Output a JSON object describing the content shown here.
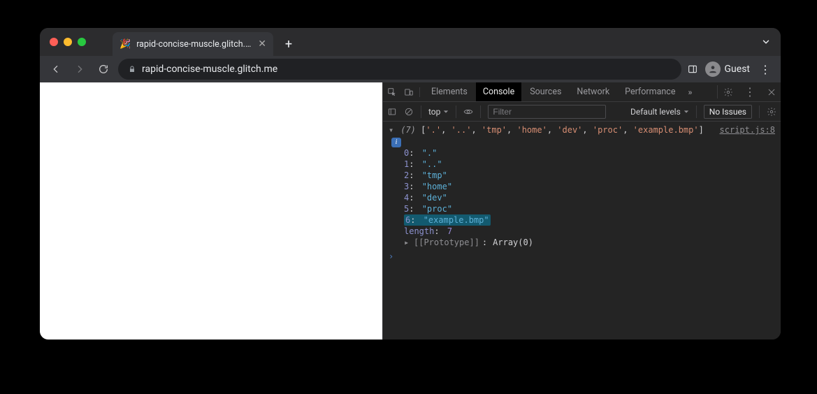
{
  "tab": {
    "title": "rapid-concise-muscle.glitch.me",
    "favicon": "🎉"
  },
  "url": "rapid-concise-muscle.glitch.me",
  "guest_label": "Guest",
  "devtools": {
    "tabs": [
      "Elements",
      "Console",
      "Sources",
      "Network",
      "Performance"
    ],
    "active_tab": "Console",
    "context_label": "top",
    "filter_placeholder": "Filter",
    "levels_label": "Default levels",
    "issues_label": "No Issues"
  },
  "console": {
    "source_link": "script.js:8",
    "array_count": "(7)",
    "summary_items": [
      ".",
      "..",
      "tmp",
      "home",
      "dev",
      "proc",
      "example.bmp"
    ],
    "entries": [
      {
        "k": "0",
        "v": "\".\""
      },
      {
        "k": "1",
        "v": "\"..\""
      },
      {
        "k": "2",
        "v": "\"tmp\""
      },
      {
        "k": "3",
        "v": "\"home\""
      },
      {
        "k": "4",
        "v": "\"dev\""
      },
      {
        "k": "5",
        "v": "\"proc\""
      },
      {
        "k": "6",
        "v": "\"example.bmp\"",
        "highlight": true
      }
    ],
    "length_key": "length",
    "length_val": "7",
    "prototype_label": "[[Prototype]]",
    "prototype_val": "Array(0)"
  }
}
